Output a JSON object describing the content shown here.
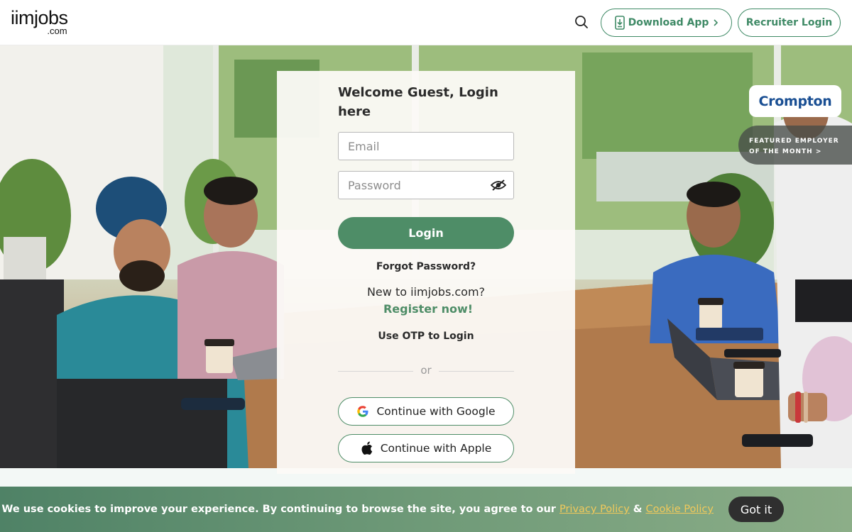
{
  "header": {
    "logo_brand": "iimjobs",
    "logo_tld": ".com",
    "search_icon": "search-icon",
    "download_app_label": "Download App",
    "recruiter_login_label": "Recruiter Login"
  },
  "featured": {
    "company": "Crompton",
    "line1": "FEATURED EMPLOYER",
    "line2": "OF THE MONTH >"
  },
  "login": {
    "welcome": "Welcome Guest, Login here",
    "email_placeholder": "Email",
    "password_placeholder": "Password",
    "login_label": "Login",
    "forgot": "Forgot Password?",
    "new_to": "New to iimjobs.com?",
    "register": "Register now!",
    "otp": "Use OTP to Login",
    "or": "or",
    "google": "Continue with Google",
    "apple": "Continue with Apple"
  },
  "cookie": {
    "text": "We use cookies to improve your experience. By continuing to browse the site, you agree to our",
    "privacy": "Privacy Policy",
    "amp": "&",
    "cookie_policy": "Cookie Policy",
    "got_it": "Got it"
  },
  "colors": {
    "brand_green": "#4e8d67",
    "crompton_blue": "#1a4f93",
    "cookie_link": "#f1c95b"
  }
}
